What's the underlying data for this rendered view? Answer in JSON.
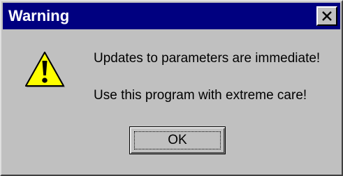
{
  "dialog": {
    "title": "Warning",
    "close_icon": "close-icon",
    "warning_icon": "warning-icon",
    "messages": [
      "Updates to parameters are immediate!",
      "Use this program with extreme care!"
    ],
    "ok_label": "OK"
  },
  "colors": {
    "titlebar": "#000080",
    "face": "#c0c0c0",
    "icon_yellow": "#ffff00"
  }
}
